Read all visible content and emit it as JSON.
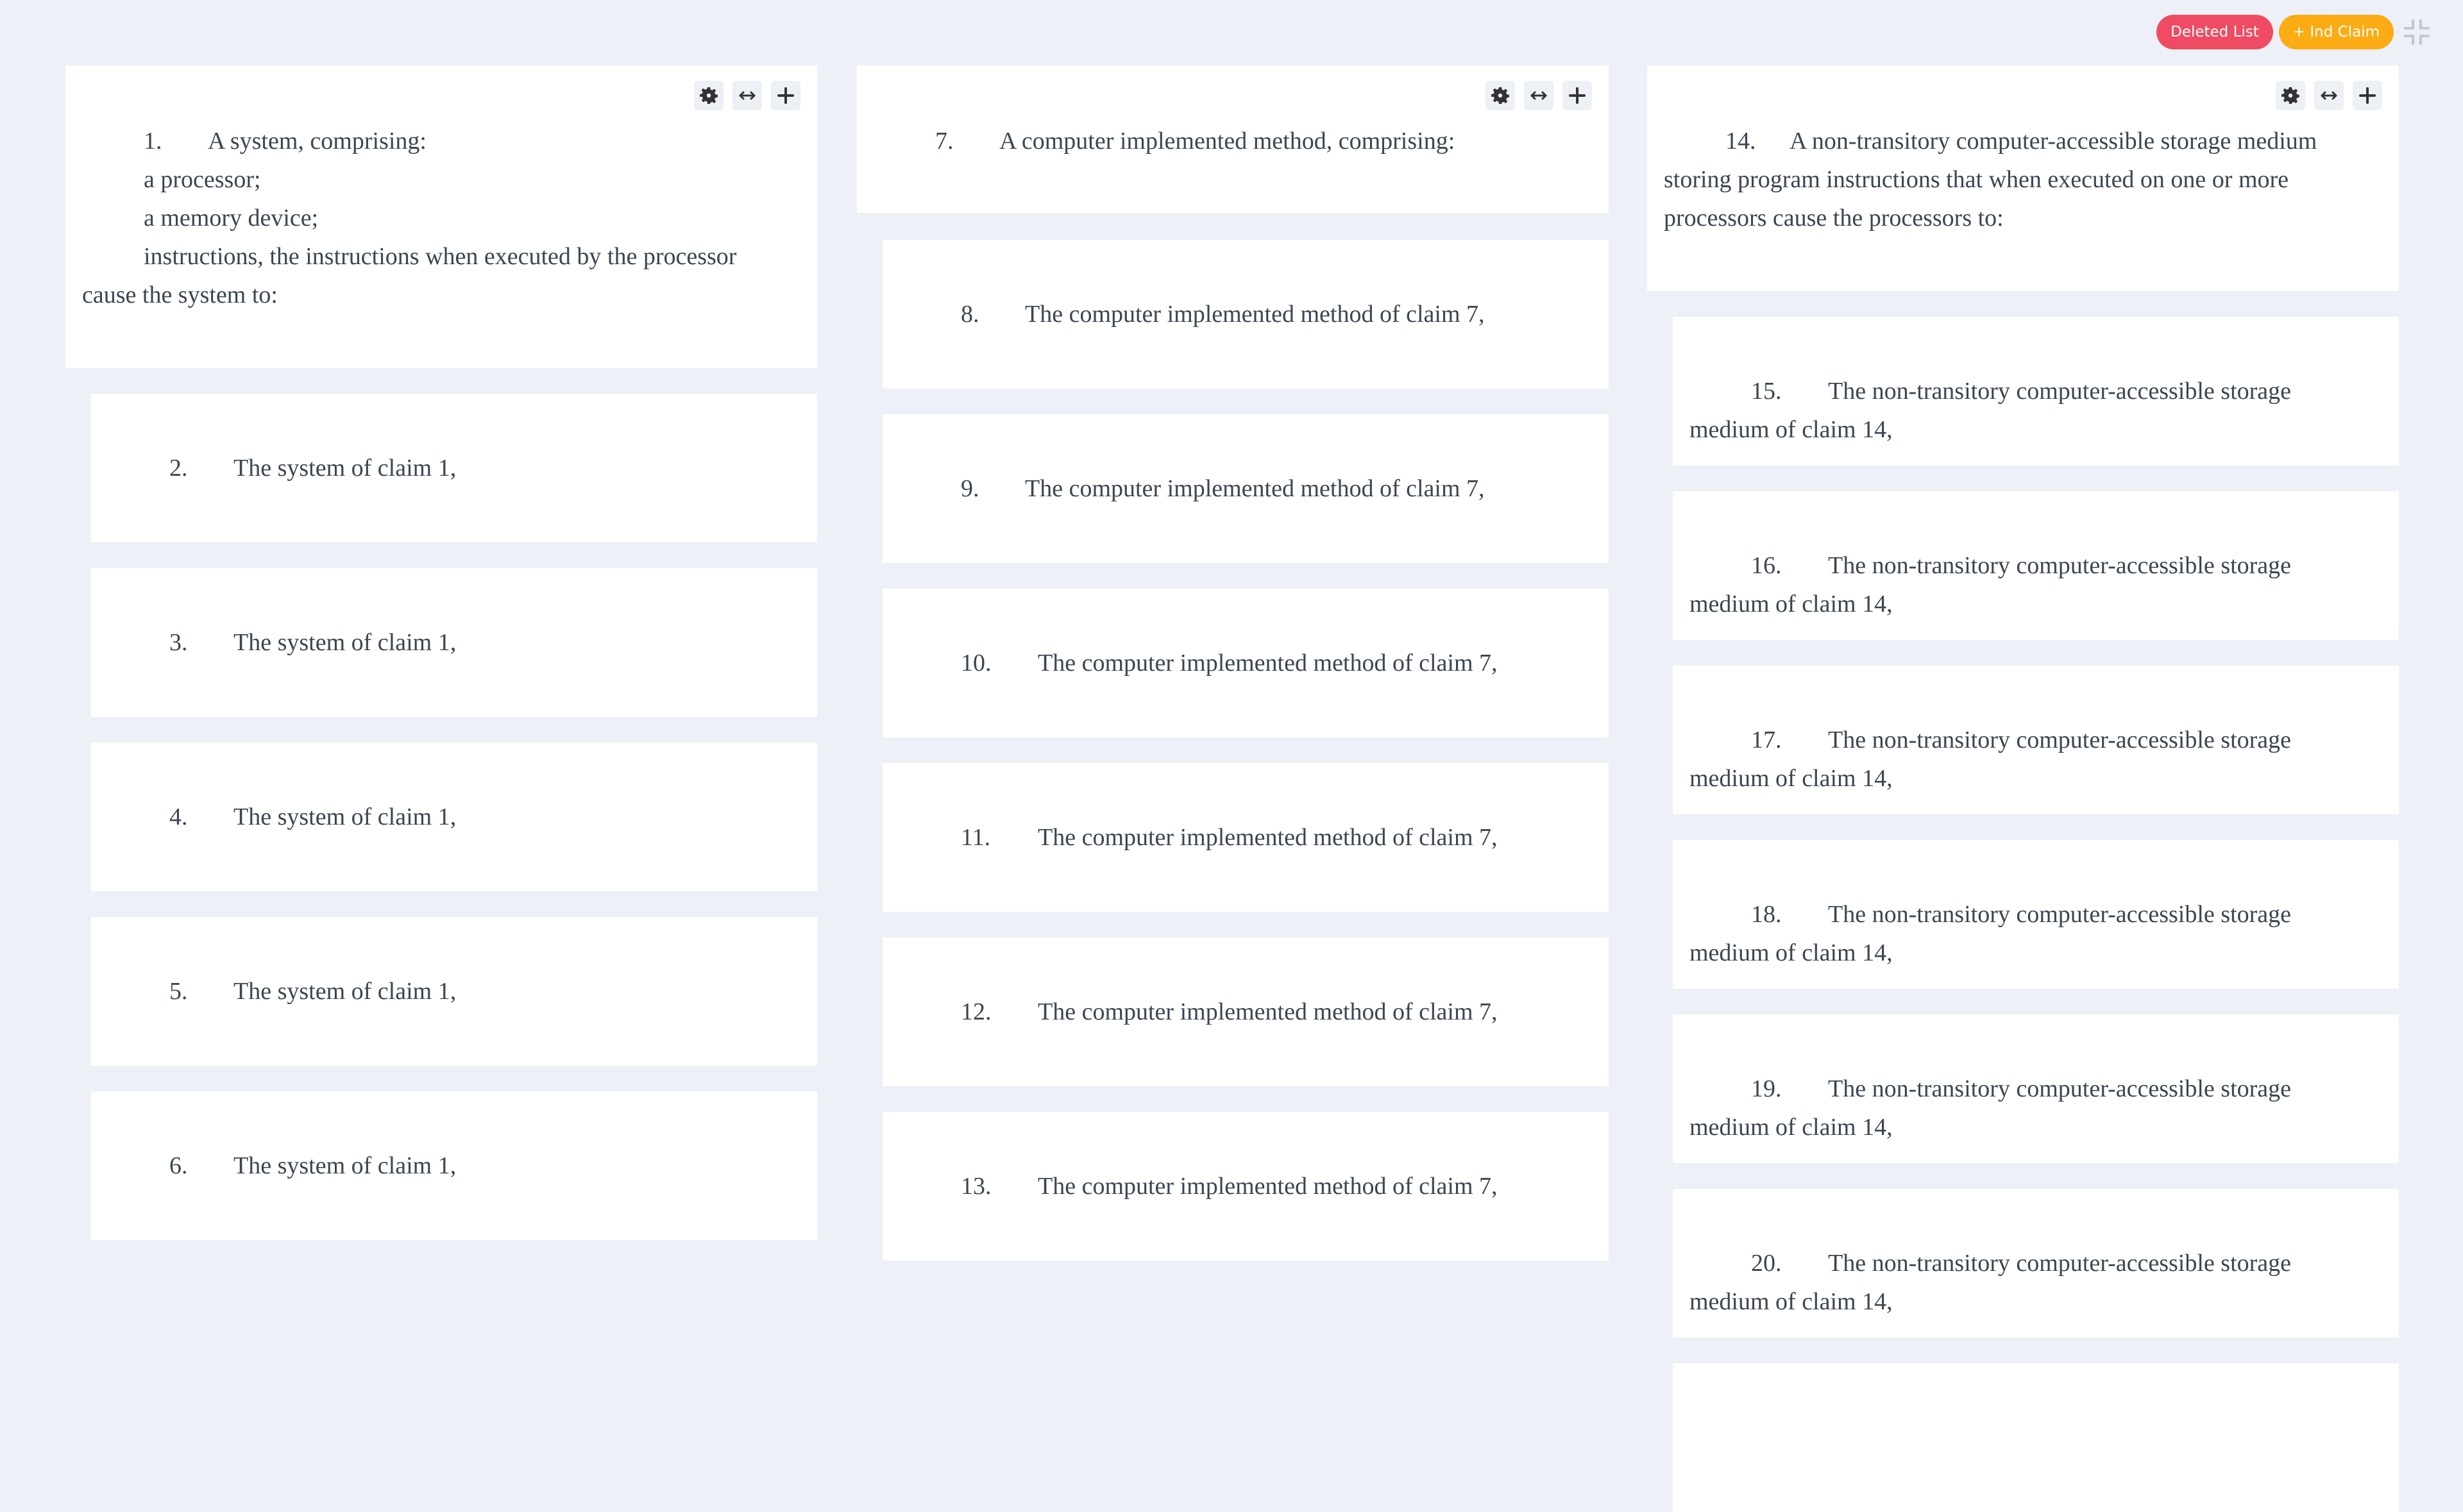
{
  "toolbar": {
    "deleted_list_label": "Deleted List",
    "ind_claim_label": "+ Ind Claim",
    "collapse_icon": "collapse-icon",
    "colors": {
      "deleted": "#ef4b62",
      "ind_claim": "#fbac14",
      "background": "#edf0f7"
    }
  },
  "card_tools": {
    "icons": [
      "gear-icon",
      "horizontal-arrows-icon",
      "plus-icon"
    ]
  },
  "columns": [
    {
      "independent": {
        "number": "1.",
        "lines": [
          "A system, comprising:",
          "a processor;",
          "a memory device;",
          "instructions, the instructions when executed by the processor cause the system to:"
        ]
      },
      "dependents": [
        {
          "number": "2.",
          "text": "The system of claim 1,"
        },
        {
          "number": "3.",
          "text": "The system of claim 1,"
        },
        {
          "number": "4.",
          "text": "The system of claim 1,"
        },
        {
          "number": "5.",
          "text": "The system of claim 1,"
        },
        {
          "number": "6.",
          "text": "The system of claim 1,"
        }
      ]
    },
    {
      "independent": {
        "number": "7.",
        "lines": [
          "A computer implemented method, comprising:"
        ]
      },
      "dependents": [
        {
          "number": "8.",
          "text": "The computer implemented method of claim 7,"
        },
        {
          "number": "9.",
          "text": "The computer implemented method of claim 7,"
        },
        {
          "number": "10.",
          "text": "The computer implemented method of claim 7,"
        },
        {
          "number": "11.",
          "text": "The computer implemented method of claim 7,"
        },
        {
          "number": "12.",
          "text": "The computer implemented method of claim 7,"
        },
        {
          "number": "13.",
          "text": "The computer implemented method of claim 7,"
        }
      ]
    },
    {
      "independent": {
        "number": "14.",
        "lines": [
          "A non-transitory computer-accessible storage medium storing program instructions that when executed on one or more processors cause the processors to:"
        ]
      },
      "dependents": [
        {
          "number": "15.",
          "text": "The non-transitory computer-accessible storage medium of claim 14,"
        },
        {
          "number": "16.",
          "text": "The non-transitory computer-accessible storage medium of claim 14,"
        },
        {
          "number": "17.",
          "text": "The non-transitory computer-accessible storage medium of claim 14,"
        },
        {
          "number": "18.",
          "text": "The non-transitory computer-accessible storage medium of claim 14,"
        },
        {
          "number": "19.",
          "text": "The non-transitory computer-accessible storage medium of claim 14,"
        },
        {
          "number": "20.",
          "text": "The non-transitory computer-accessible storage medium of claim 14,"
        },
        {
          "number": "",
          "text": ""
        }
      ]
    }
  ]
}
